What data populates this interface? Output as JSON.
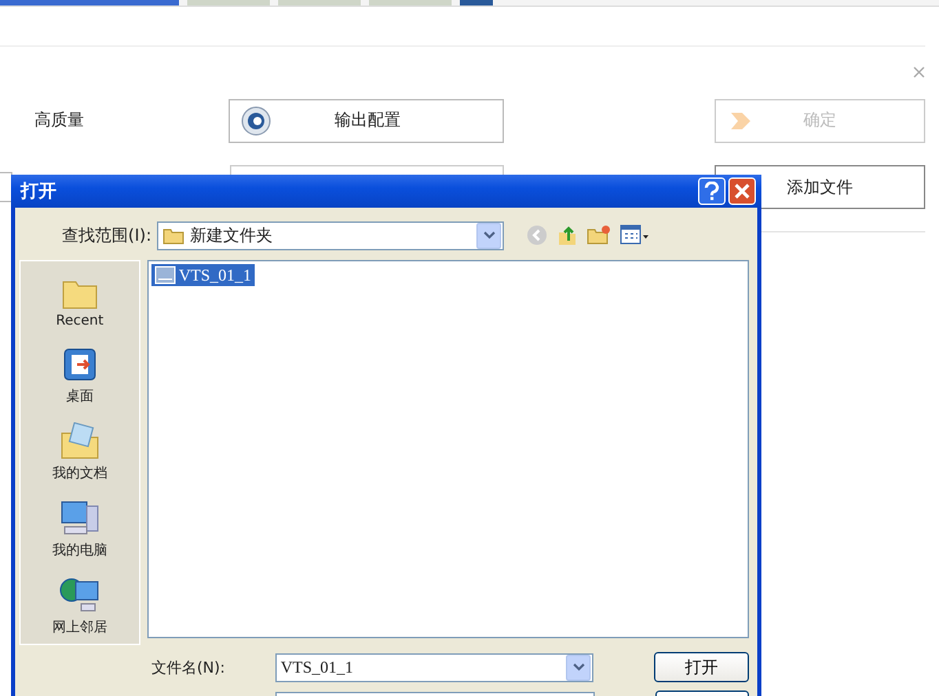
{
  "app": {
    "quality_label": "高质量",
    "output_button": "输出配置",
    "ok_button": {
      "label": "确定",
      "disabled": true
    },
    "add_button": "添加文件"
  },
  "dialog": {
    "title": "打开",
    "look_in_label": "查找范围(I):",
    "look_in_value": "新建文件夹",
    "places": [
      {
        "label": "Recent",
        "kind": "recent"
      },
      {
        "label": "桌面",
        "kind": "desktop"
      },
      {
        "label": "我的文档",
        "kind": "documents"
      },
      {
        "label": "我的电脑",
        "kind": "computer"
      },
      {
        "label": "网上邻居",
        "kind": "network"
      }
    ],
    "files": [
      {
        "name": "VTS_01_1",
        "selected": true
      }
    ],
    "file_name_label": "文件名(N):",
    "file_name_value": "VTS_01_1",
    "open_button": "打开"
  }
}
